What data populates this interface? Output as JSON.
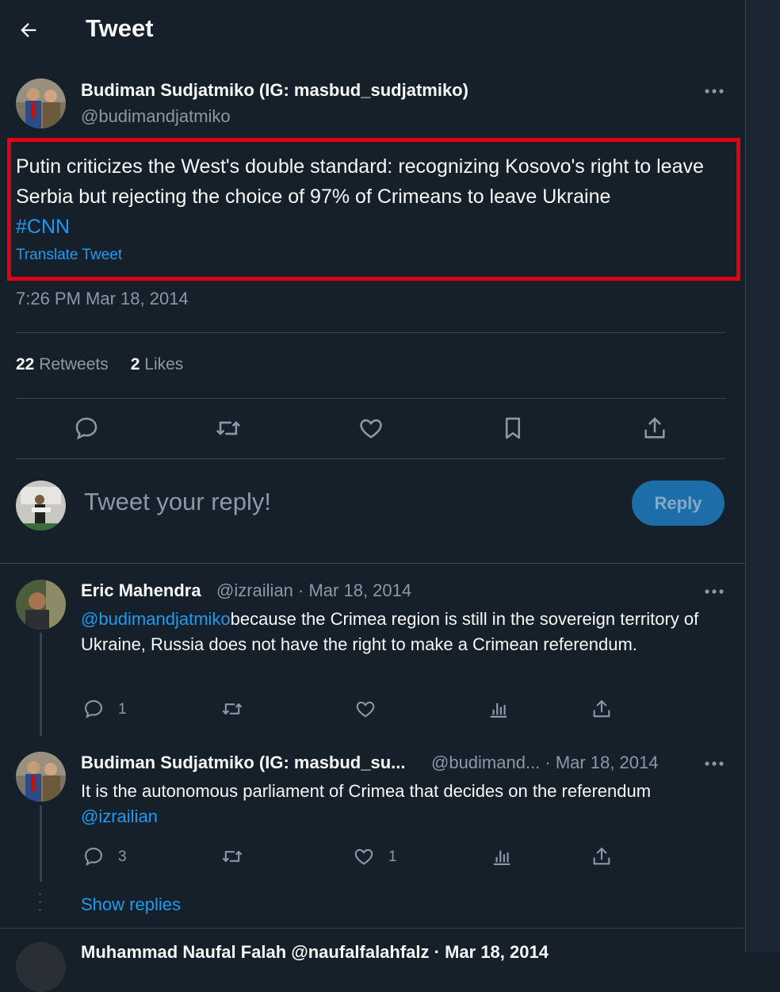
{
  "header": {
    "title": "Tweet"
  },
  "tweet": {
    "author_name": "Budiman Sudjatmiko (IG: masbud_sudjatmiko)",
    "author_handle": "@budimandjatmiko",
    "text": "Putin criticizes the West's double standard: recognizing Kosovo's right to leave Serbia but rejecting the choice of 97% of Crimeans to leave Ukraine",
    "hashtag": "#CNN",
    "translate_label": "Translate Tweet",
    "timestamp": "7:26 PM Mar 18, 2014",
    "retweets_count": "22",
    "retweets_label": "Retweets",
    "likes_count": "2",
    "likes_label": "Likes"
  },
  "composer": {
    "placeholder": "Tweet your reply!",
    "reply_button": "Reply"
  },
  "replies": [
    {
      "name": "Eric Mahendra",
      "meta": "@izrailian · Mar 18, 2014",
      "mention": "@budimandjatmiko",
      "text": "because the Crimea region is still in the sovereign territory of Ukraine, Russia does not have the right to make a Crimean referendum.",
      "reply_count": "1",
      "retweet_count": "",
      "like_count": ""
    },
    {
      "name": "Budiman Sudjatmiko (IG: masbud_su...",
      "meta": "@budimand... · Mar 18, 2014",
      "text": "It is the autonomous parliament of Crimea that decides on the referendum",
      "mention": "@izrailian",
      "reply_count": "3",
      "retweet_count": "",
      "like_count": "1"
    }
  ],
  "show_replies_label": "Show replies",
  "next_reply_partial": "Muhammad Naufal Falah @naufalfalahfalz · Mar 18, 2014",
  "colors": {
    "background": "#15202b",
    "accent": "#1d9bf0",
    "secondary_text": "#8b98a5",
    "highlight_box": "#e3000f"
  }
}
